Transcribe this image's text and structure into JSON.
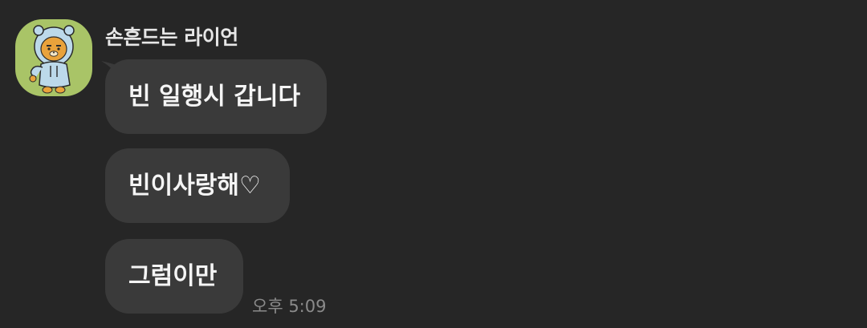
{
  "chat": {
    "sender": {
      "name": "손흔드는 라이언",
      "avatar": "ryan-character-sticker"
    },
    "messages": [
      {
        "text": "빈 일행시 갑니다"
      },
      {
        "text": "빈이사랑해♡"
      },
      {
        "text": "그럼이만"
      }
    ],
    "timestamp": "오후 5:09"
  },
  "colors": {
    "background": "#262626",
    "bubble": "#3a3a3a",
    "avatar_bg": "#a9c467",
    "text": "#f5f5f5",
    "timestamp": "#8a8a8a"
  }
}
